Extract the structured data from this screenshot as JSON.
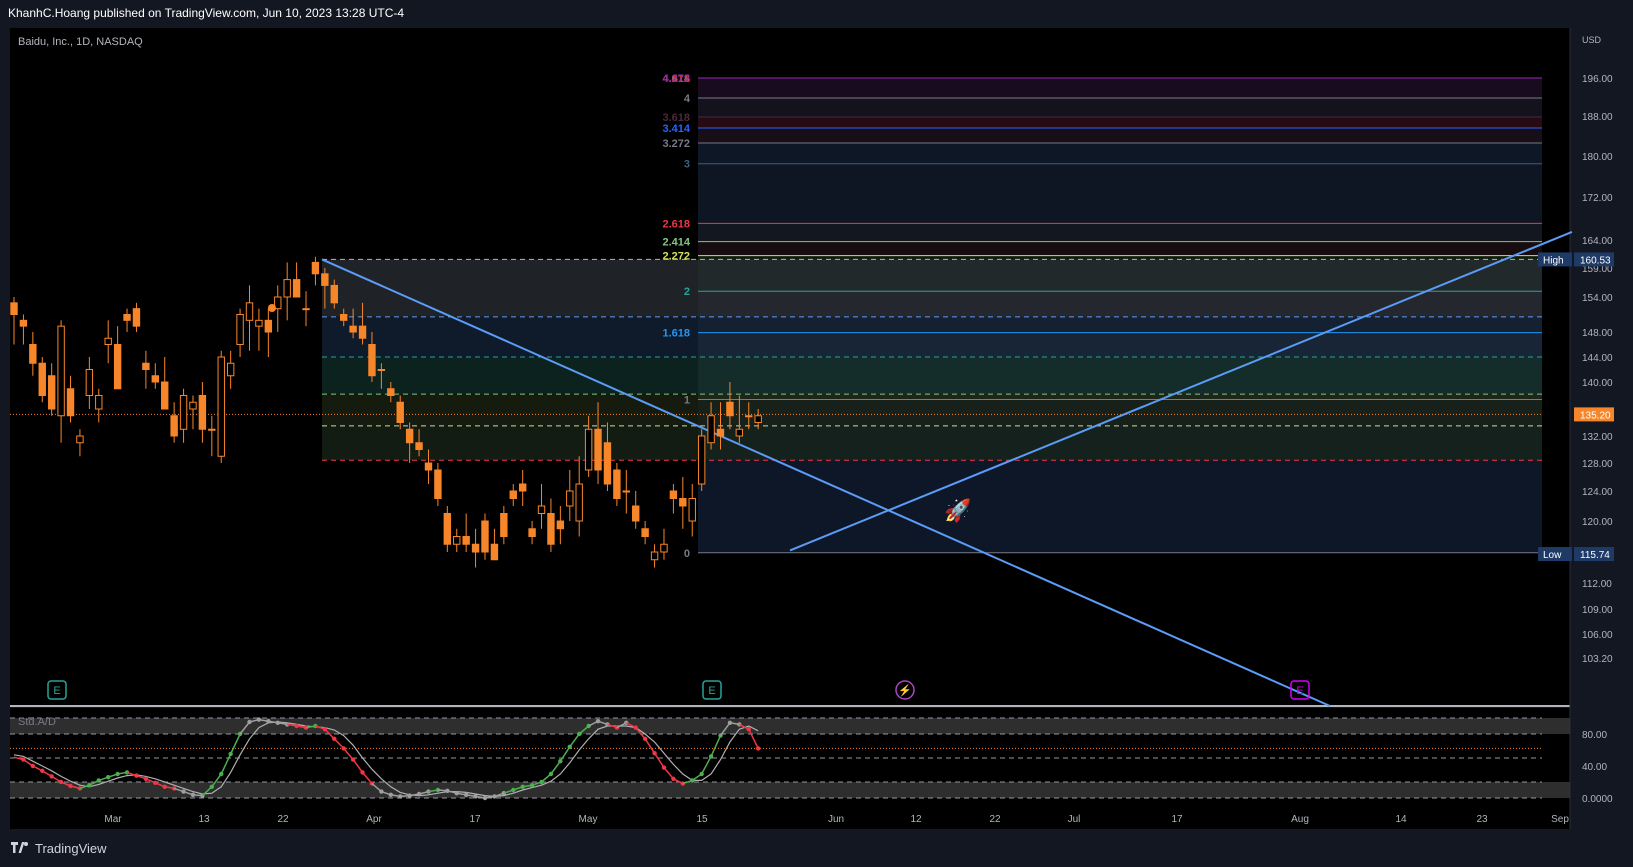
{
  "header": {
    "published": "KhanhC.Hoang published on TradingView.com, Jun 10, 2023 13:28 UTC-4"
  },
  "footer": {
    "brand": "TradingView"
  },
  "colors": {
    "background": "#000000",
    "frame": "#131722",
    "candle": "#f7862a",
    "trendline": "#5b9cf6",
    "stoch_k_up": "#4caf50",
    "stoch_k_down": "#f23645",
    "stoch_d": "#b0b0b0"
  },
  "chart_data": {
    "type": "candlestick",
    "symbol": "Baidu, Inc., 1D, NASDAQ",
    "currency": "USD",
    "last_price": {
      "value": 135.2,
      "label": "135.20"
    },
    "high_marker": {
      "label": "High",
      "value": 160.53,
      "text": "160.53"
    },
    "low_marker": {
      "label": "Low",
      "value": 115.74,
      "text": "115.74"
    },
    "y_ticks": [
      196,
      188,
      180,
      172,
      164,
      159,
      154,
      148,
      144,
      140,
      132,
      128,
      124,
      120,
      112,
      109,
      106,
      103.2
    ],
    "y_tick_labels": [
      "196.00",
      "188.00",
      "180.00",
      "172.00",
      "164.00",
      "159.00",
      "154.00",
      "148.00",
      "144.00",
      "140.00",
      "132.00",
      "128.00",
      "124.00",
      "120.00",
      "112.00",
      "109.00",
      "106.00",
      "103.20"
    ],
    "x_labels": [
      "Mar",
      "13",
      "22",
      "Apr",
      "17",
      "May",
      "15",
      "Jun",
      "12",
      "22",
      "Jul",
      "17",
      "Aug",
      "14",
      "23",
      "Sep"
    ],
    "fib_levels": [
      {
        "label": "4.618",
        "color": "#4caf50",
        "value": 198.8
      },
      {
        "label": "4.414",
        "color": "#f23645",
        "value": 197.7
      },
      {
        "label": "4.272",
        "color": "#9c27b0",
        "value": 196.3
      },
      {
        "label": "4",
        "color": "#787b86",
        "value": 191.8
      },
      {
        "label": "3.618",
        "color": "#4a2a3a",
        "value": 187.8
      },
      {
        "label": "3.414",
        "color": "#2962ff",
        "value": 185.6
      },
      {
        "label": "3.272",
        "color": "#787b86",
        "value": 182.6
      },
      {
        "label": "3",
        "color": "#3f5f7f",
        "value": 178.5
      },
      {
        "label": "2.618",
        "color": "#f23645",
        "value": 167.1
      },
      {
        "label": "2.414",
        "color": "#81c784",
        "value": 163.7
      },
      {
        "label": "2.272",
        "color": "#d4e157",
        "value": 161.2
      },
      {
        "label": "2",
        "color": "#26a69a",
        "value": 155.0
      },
      {
        "label": "1.618",
        "color": "#2196f3",
        "value": 147.9
      },
      {
        "label": "1",
        "color": "#787b86",
        "value": 137.4
      },
      {
        "label": "0",
        "color": "#787b86",
        "value": 115.9
      }
    ],
    "candles": [
      [
        153,
        154,
        146,
        151
      ],
      [
        150,
        151,
        146,
        149
      ],
      [
        146,
        148,
        141,
        143
      ],
      [
        143,
        144,
        137,
        138
      ],
      [
        141,
        143,
        135,
        136
      ],
      [
        135,
        150,
        131,
        149
      ],
      [
        139,
        141,
        134,
        135
      ],
      [
        131,
        133,
        129,
        132
      ],
      [
        138,
        144,
        136,
        142
      ],
      [
        136,
        139,
        134,
        138
      ],
      [
        146,
        150,
        143,
        147
      ],
      [
        146,
        149,
        139,
        139
      ],
      [
        151,
        152,
        148,
        150
      ],
      [
        152,
        153,
        148,
        149
      ],
      [
        143,
        145,
        139,
        142
      ],
      [
        141,
        143,
        139,
        140
      ],
      [
        140,
        144,
        136,
        136
      ],
      [
        135,
        137,
        131,
        132
      ],
      [
        133,
        139,
        131,
        138
      ],
      [
        136,
        138,
        133,
        137
      ],
      [
        138,
        140,
        131,
        133
      ],
      [
        133,
        135,
        129,
        133
      ],
      [
        129,
        145,
        128,
        144
      ],
      [
        141,
        145,
        139,
        143
      ],
      [
        146,
        152,
        144,
        151
      ],
      [
        150,
        156,
        145,
        153
      ],
      [
        149,
        152,
        145,
        150
      ],
      [
        150,
        152,
        144,
        148
      ],
      [
        152,
        156,
        148,
        154
      ],
      [
        154,
        160,
        150,
        157
      ],
      [
        157,
        160,
        154,
        154
      ],
      [
        152,
        155,
        149,
        152
      ],
      [
        160,
        161,
        156,
        158
      ],
      [
        158,
        159,
        152,
        156
      ],
      [
        156,
        157,
        152,
        153
      ],
      [
        151,
        152,
        149,
        150
      ],
      [
        149,
        152,
        147,
        148
      ],
      [
        149,
        153,
        146,
        147
      ],
      [
        146,
        148,
        140,
        141
      ],
      [
        142,
        143,
        139,
        142
      ],
      [
        139,
        140,
        137,
        138
      ],
      [
        137,
        138,
        133,
        134
      ],
      [
        133,
        134,
        128,
        131
      ],
      [
        131,
        133,
        129,
        130
      ],
      [
        128,
        130,
        125,
        127
      ],
      [
        127,
        128,
        122,
        123
      ],
      [
        121,
        122,
        116,
        117
      ],
      [
        117,
        119,
        116,
        118
      ],
      [
        118,
        121,
        116,
        117
      ],
      [
        117,
        119,
        114,
        116
      ],
      [
        120,
        121,
        115,
        116
      ],
      [
        117,
        119,
        115,
        115
      ],
      [
        121,
        122,
        117,
        118
      ],
      [
        124,
        125,
        122,
        123
      ],
      [
        125,
        127,
        122,
        124
      ],
      [
        119,
        120,
        117,
        118
      ],
      [
        121,
        125,
        119,
        122
      ],
      [
        121,
        123,
        116,
        117
      ],
      [
        120,
        122,
        117,
        119
      ],
      [
        122,
        127,
        120,
        124
      ],
      [
        120,
        129,
        118,
        125
      ],
      [
        127,
        135,
        126,
        133
      ],
      [
        133,
        137,
        125,
        127
      ],
      [
        131,
        134,
        124,
        125
      ],
      [
        127,
        128,
        122,
        123
      ],
      [
        124,
        127,
        121,
        124
      ],
      [
        122,
        124,
        119,
        120
      ],
      [
        119,
        120,
        117,
        118
      ],
      [
        115,
        117,
        114,
        116
      ],
      [
        116,
        119,
        115,
        117
      ],
      [
        124,
        125,
        121,
        123
      ],
      [
        123,
        126,
        119,
        122
      ],
      [
        120,
        125,
        118,
        123
      ],
      [
        125,
        133,
        124,
        132
      ],
      [
        131,
        137,
        130,
        135
      ],
      [
        133,
        137,
        130,
        132
      ],
      [
        137,
        140,
        133,
        135
      ],
      [
        132,
        138,
        131,
        133
      ],
      [
        135,
        137,
        133,
        135
      ],
      [
        134,
        136,
        133,
        135
      ]
    ],
    "lower_pane": {
      "title": "Std.A/D",
      "y_ticks": [
        80,
        40,
        0
      ],
      "y_tick_labels": [
        "80.00",
        "40.00",
        "0.0000"
      ],
      "k": [
        51,
        48,
        40,
        34,
        27,
        20,
        15,
        12,
        16,
        22,
        26,
        30,
        32,
        28,
        24,
        19,
        14,
        12,
        8,
        4,
        3,
        14,
        30,
        55,
        80,
        95,
        98,
        96,
        94,
        92,
        90,
        88,
        90,
        86,
        74,
        62,
        48,
        32,
        18,
        8,
        4,
        2,
        3,
        5,
        8,
        10,
        9,
        6,
        4,
        2,
        0,
        2,
        6,
        10,
        14,
        16,
        20,
        30,
        46,
        64,
        80,
        90,
        96,
        92,
        88,
        94,
        88,
        74,
        56,
        38,
        24,
        18,
        22,
        30,
        52,
        78,
        94,
        92,
        86,
        62
      ],
      "d": [
        54,
        52,
        46,
        40,
        34,
        27,
        21,
        16,
        14,
        17,
        21,
        25,
        28,
        29,
        27,
        24,
        20,
        16,
        12,
        8,
        5,
        6,
        14,
        32,
        54,
        74,
        88,
        94,
        95,
        94,
        92,
        90,
        89,
        88,
        85,
        78,
        66,
        50,
        36,
        24,
        14,
        7,
        4,
        3,
        4,
        6,
        8,
        8,
        7,
        5,
        3,
        2,
        3,
        6,
        10,
        13,
        16,
        21,
        30,
        44,
        60,
        74,
        86,
        90,
        90,
        90,
        88,
        80,
        70,
        56,
        42,
        30,
        22,
        22,
        30,
        48,
        70,
        86,
        90,
        84
      ]
    }
  }
}
